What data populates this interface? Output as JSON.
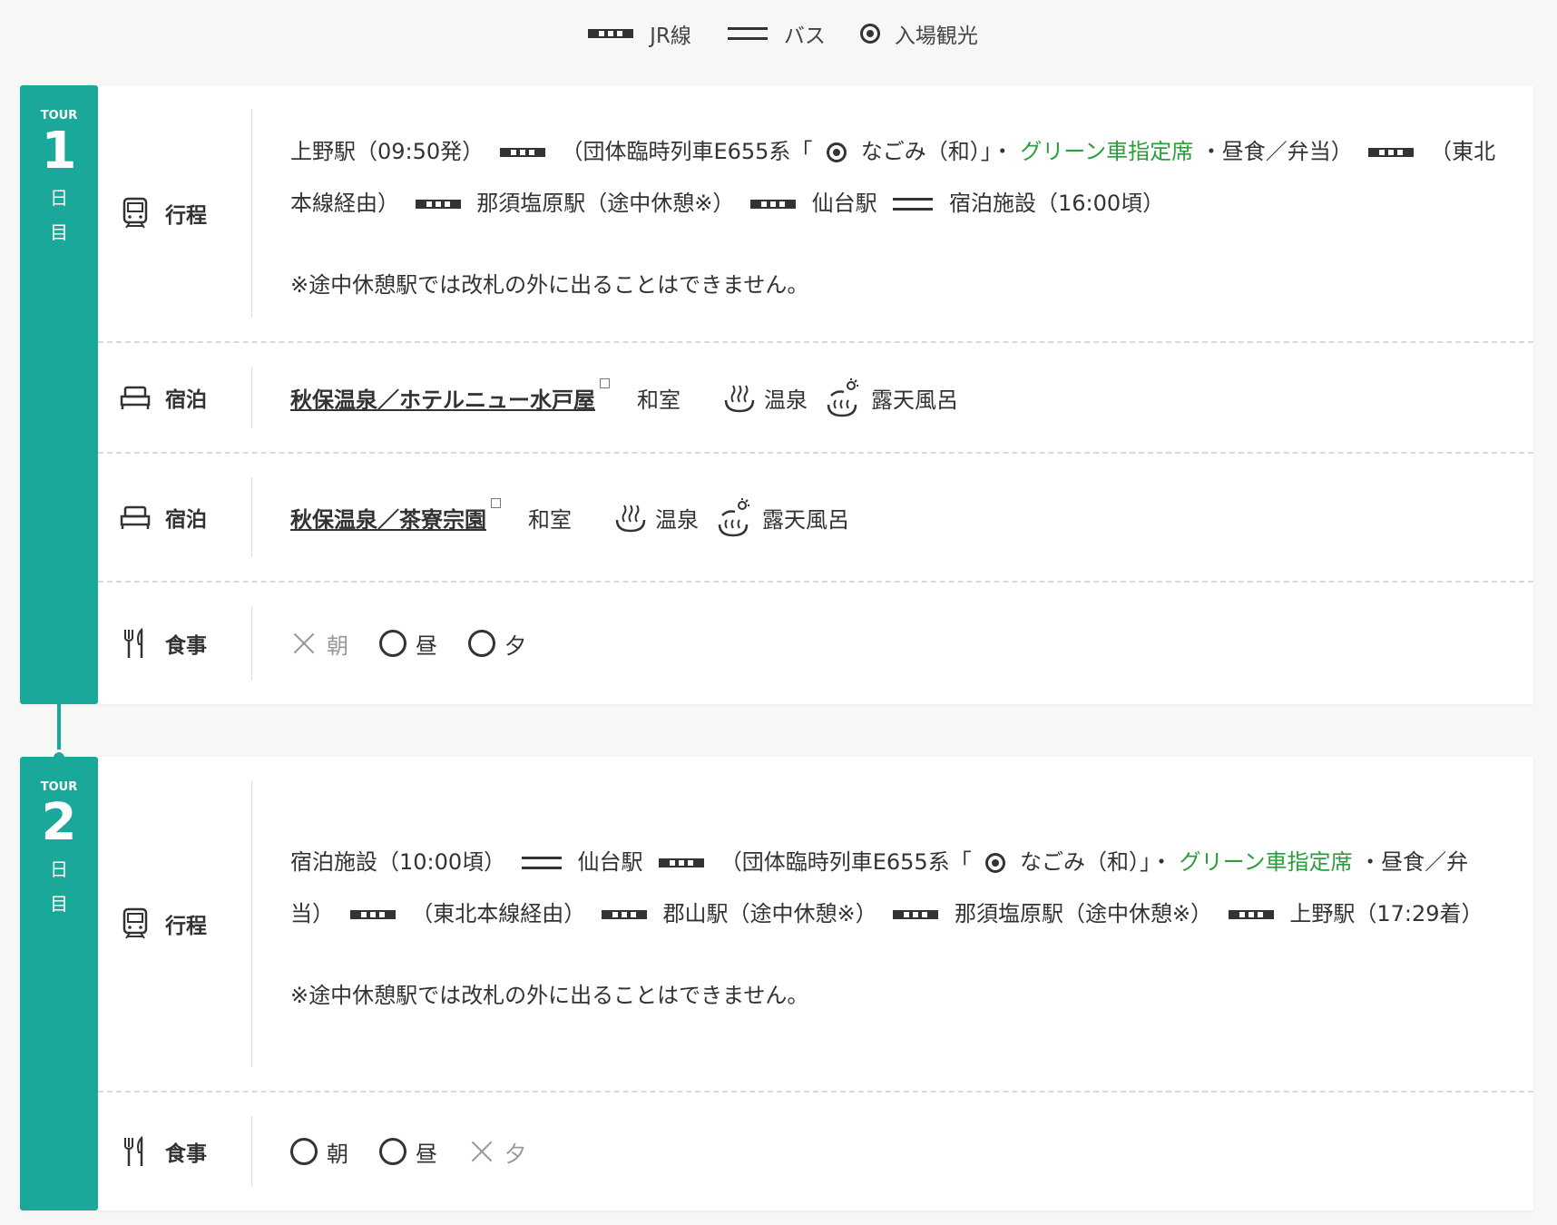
{
  "legend": {
    "train": "JR線",
    "bus": "バス",
    "spot": "入場観光"
  },
  "days": [
    {
      "tour_label": "TOUR",
      "number": "1",
      "nichi": "日",
      "me": "目",
      "itinerary": {
        "label": "行程",
        "s1": "上野駅（09:50発）",
        "s2": "（団体臨時列車E655系「",
        "s3": "なごみ（和）」・",
        "green": "グリーン車指定席",
        "s4": "・昼食／弁当）",
        "s5": "（東北本線経由）",
        "s6": "那須塩原駅（途中休憩※）",
        "s7": "仙台駅",
        "s8": "宿泊施設（16:00頃）",
        "note": "※途中休憩駅では改札の外に出ることはできません。"
      },
      "lodgings": [
        {
          "label": "宿泊",
          "name": "秋保温泉／ホテルニュー水戸屋",
          "room": "和室",
          "onsen": "温泉",
          "rotenburo": "露天風呂"
        },
        {
          "label": "宿泊",
          "name": "秋保温泉／茶寮宗園",
          "room": "和室",
          "onsen": "温泉",
          "rotenburo": "露天風呂"
        }
      ],
      "meals": {
        "label": "食事",
        "items": [
          {
            "name": "朝",
            "included": false
          },
          {
            "name": "昼",
            "included": true
          },
          {
            "name": "夕",
            "included": true
          }
        ]
      }
    },
    {
      "tour_label": "TOUR",
      "number": "2",
      "nichi": "日",
      "me": "目",
      "itinerary": {
        "label": "行程",
        "s1": "宿泊施設（10:00頃）",
        "s2": "仙台駅",
        "s3": "（団体臨時列車E655系「",
        "s4": "なごみ（和）」・",
        "green": "グリーン車指定席",
        "s5": "・昼食／弁当）",
        "s6": "（東北本線経由）",
        "s7": "郡山駅（途中休憩※）",
        "s8": "那須塩原駅（途中休憩※）",
        "s9": "上野駅（17:29着）",
        "note": "※途中休憩駅では改札の外に出ることはできません。"
      },
      "meals": {
        "label": "食事",
        "items": [
          {
            "name": "朝",
            "included": true
          },
          {
            "name": "昼",
            "included": true
          },
          {
            "name": "夕",
            "included": false
          }
        ]
      }
    }
  ]
}
